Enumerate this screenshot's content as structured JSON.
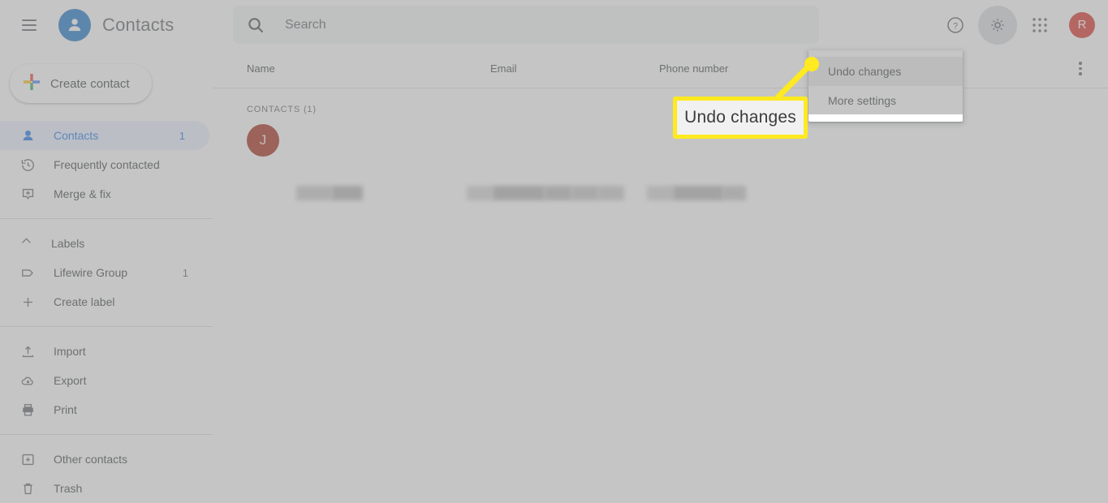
{
  "app": {
    "title": "Contacts",
    "logo_icon": "contacts-person-icon",
    "menu_icon": "hamburger-menu-icon"
  },
  "search": {
    "placeholder": "Search",
    "value": "",
    "icon": "search-icon"
  },
  "topbar_actions": [
    {
      "name": "help-button",
      "icon": "help-circle-icon",
      "label": "Help"
    },
    {
      "name": "settings-button",
      "icon": "gear-icon",
      "label": "Settings",
      "pressed": true
    },
    {
      "name": "google-apps-button",
      "icon": "grid-apps-icon",
      "label": "Google apps"
    },
    {
      "name": "account-avatar",
      "icon": "avatar-icon",
      "label": "R"
    }
  ],
  "sidebar": {
    "create_contact": {
      "label": "Create contact",
      "icon": "google-plus-icon"
    },
    "items": [
      {
        "label": "Contacts",
        "icon": "person-icon",
        "count": "1",
        "active": true
      },
      {
        "label": "Frequently contacted",
        "icon": "history-clock-icon",
        "count": "",
        "active": false
      },
      {
        "label": "Merge & fix",
        "icon": "merge-fix-icon",
        "count": "",
        "active": false
      }
    ],
    "labels_section": {
      "header_label": "Labels",
      "header_icon": "chevron-up-icon",
      "items": [
        {
          "label": "Lifewire Group",
          "icon": "label-tag-icon",
          "count": "1",
          "active": false
        },
        {
          "label": "Create label",
          "icon": "plus-icon",
          "count": "",
          "active": false
        }
      ]
    },
    "tools": [
      {
        "label": "Import",
        "icon": "import-upload-icon",
        "count": "",
        "active": false
      },
      {
        "label": "Export",
        "icon": "export-cloud-download-icon",
        "count": "",
        "active": false
      },
      {
        "label": "Print",
        "icon": "printer-icon",
        "count": "",
        "active": false
      }
    ],
    "bottom": [
      {
        "label": "Other contacts",
        "icon": "other-contacts-icon",
        "count": "",
        "active": false
      },
      {
        "label": "Trash",
        "icon": "trash-icon",
        "count": "",
        "active": false
      }
    ]
  },
  "contact_list": {
    "columns": {
      "name": "Name",
      "email": "Email",
      "phone": "Phone number"
    },
    "more_options_icon": "more-vert-icon",
    "group_label": "CONTACTS (1)",
    "rows": [
      {
        "avatar_initial": "J",
        "avatar_color": "#a52714",
        "name": "",
        "email": "",
        "phone": "",
        "redacted": true
      }
    ]
  },
  "settings_menu": {
    "items": [
      {
        "label": "Undo changes",
        "hovered": true
      },
      {
        "label": "More settings",
        "hovered": false
      }
    ]
  },
  "annotation": {
    "callout_text": "Undo changes",
    "highlight_color": "#ffe920",
    "box_fill": "#f1f1f1"
  },
  "colors": {
    "brand_blue": "#1a73c8",
    "accent_blue": "#1a73e8",
    "active_pill": "#e8f0fe",
    "avatar_red": "#d93025",
    "contact_avatar": "#a52714",
    "scrim": "rgba(150,150,150,0.55)"
  }
}
